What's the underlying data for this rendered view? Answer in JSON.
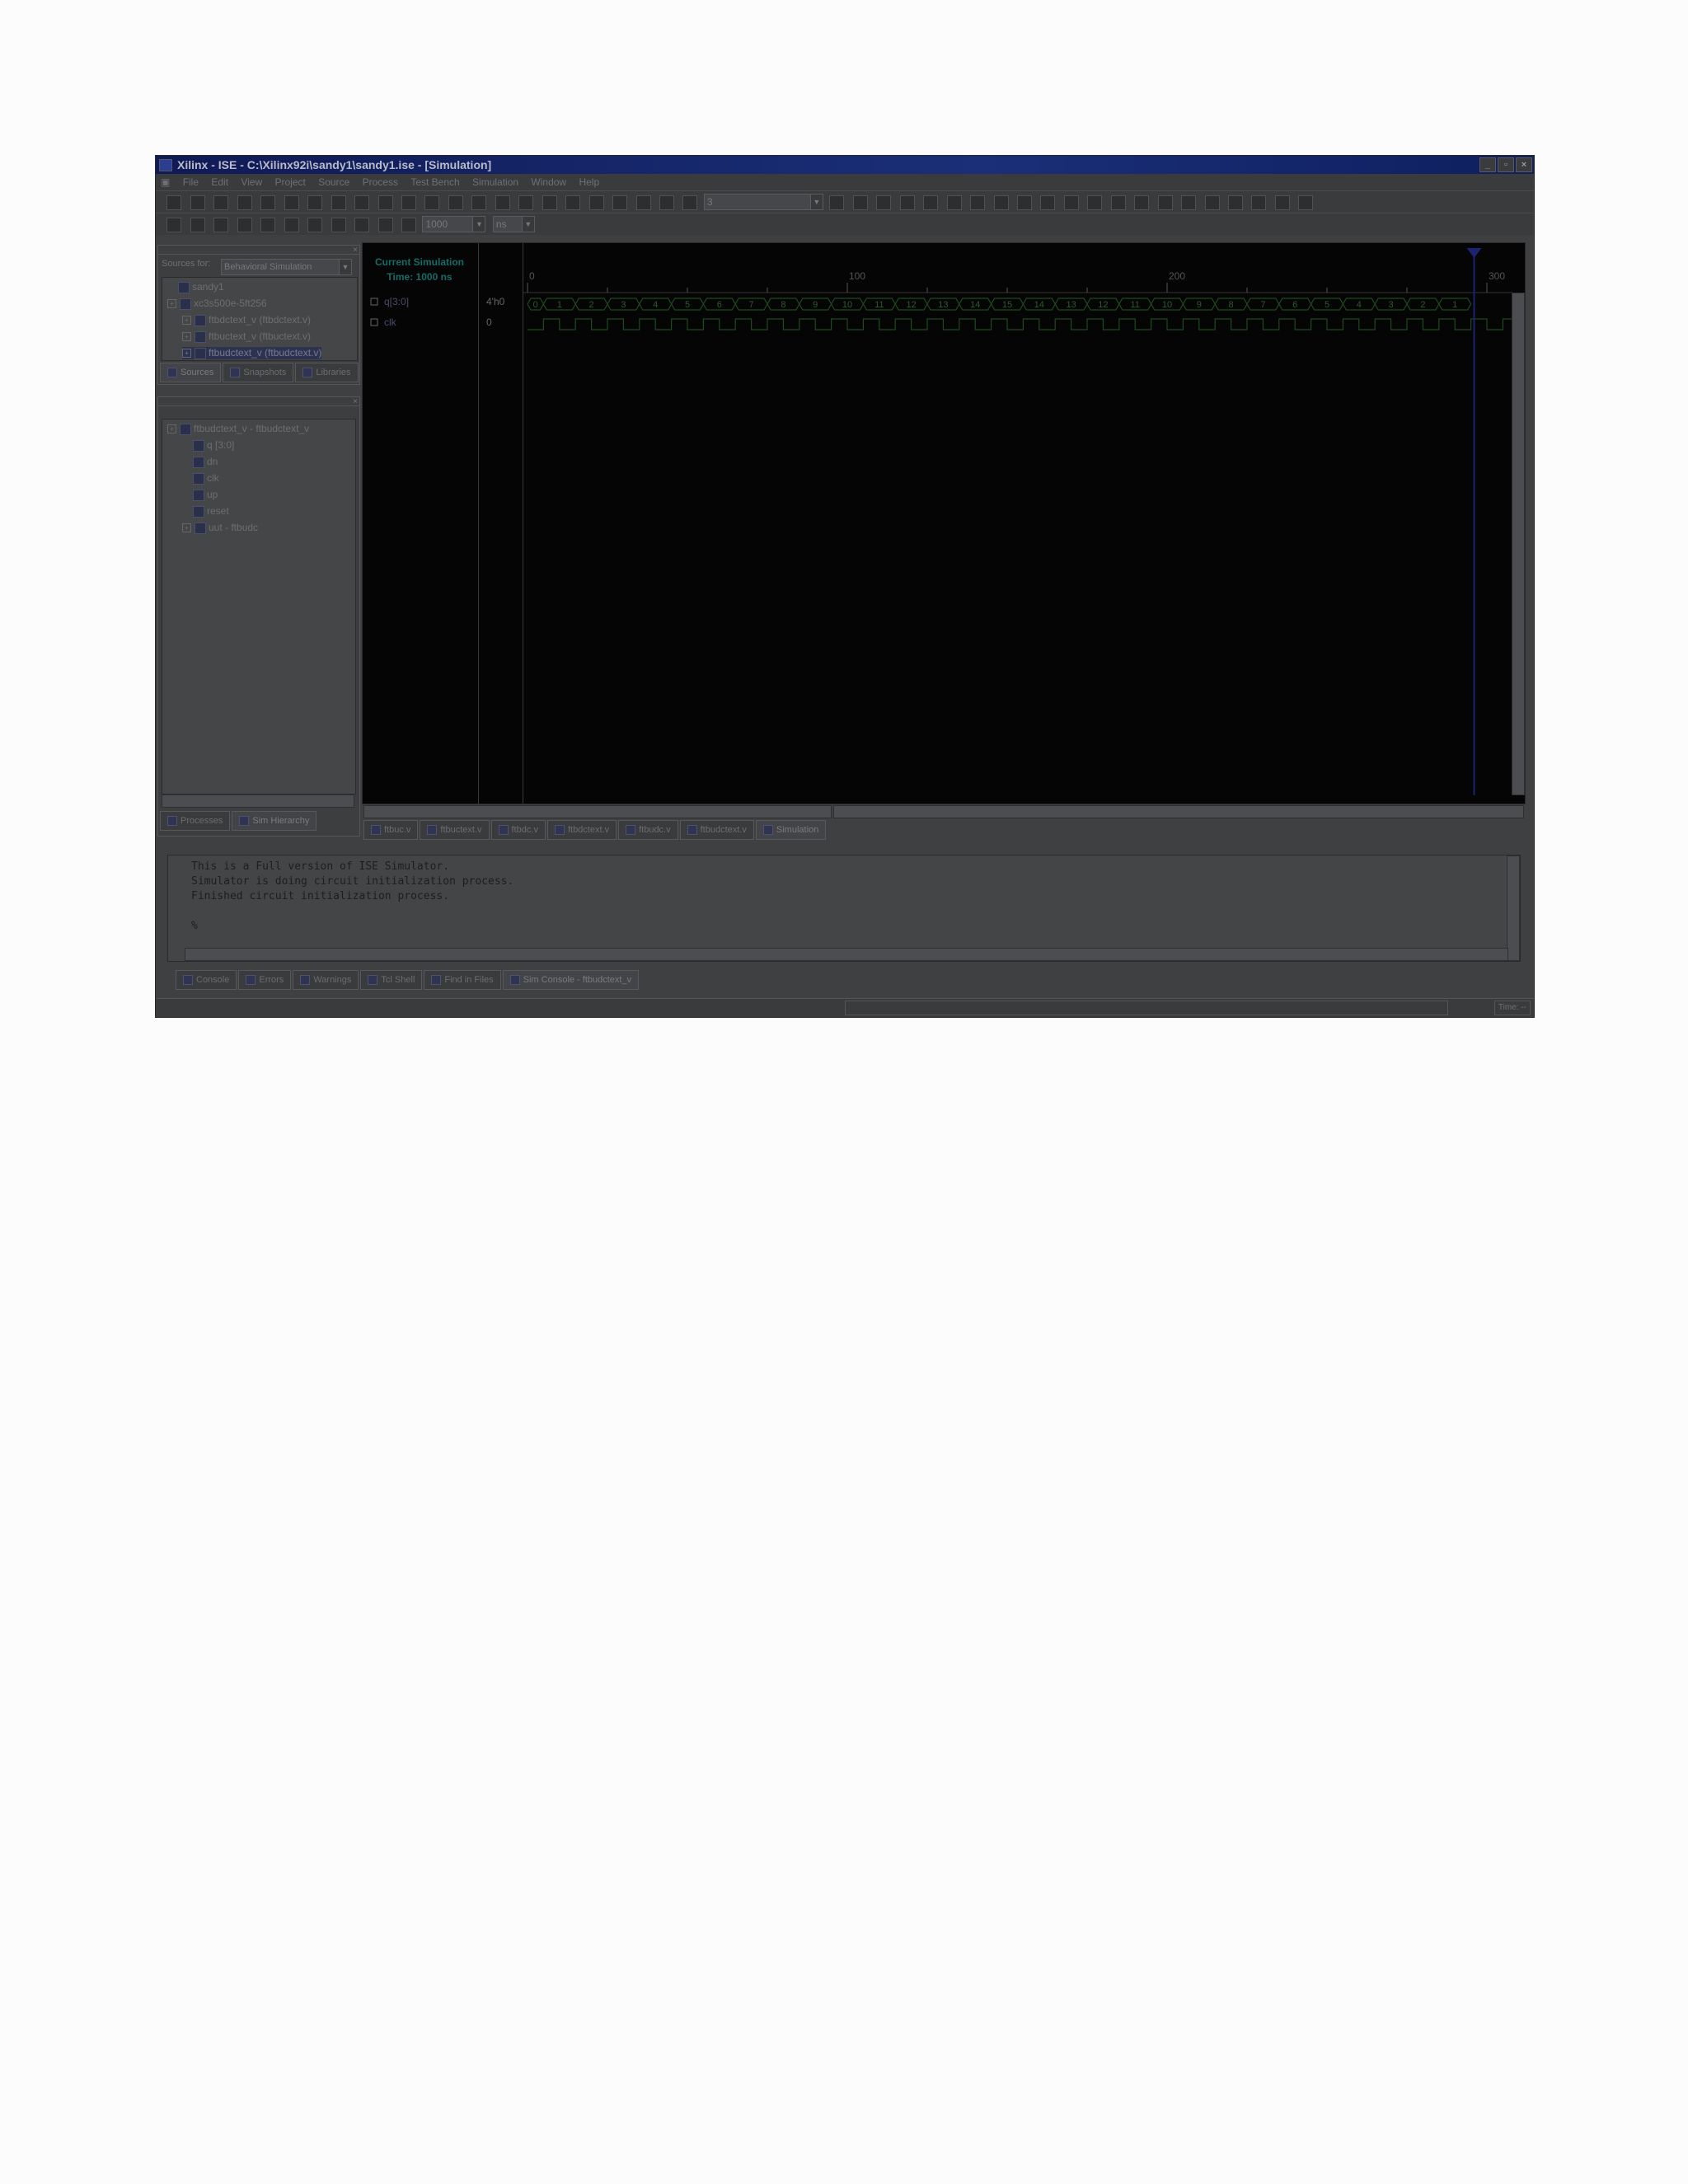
{
  "window": {
    "title": "Xilinx - ISE - C:\\Xilinx92i\\sandy1\\sandy1.ise - [Simulation]",
    "controls": [
      "_",
      "▫",
      "×"
    ]
  },
  "menu": [
    "File",
    "Edit",
    "View",
    "Project",
    "Source",
    "Process",
    "Test Bench",
    "Simulation",
    "Window",
    "Help"
  ],
  "toolbar": {
    "search_combo_value": "3",
    "sim_time_value": "1000",
    "sim_time_unit": "ns"
  },
  "sources_panel": {
    "label": "Sources for:",
    "view_value": "Behavioral Simulation",
    "tree": [
      {
        "text": "sandy1",
        "indent": 0,
        "plus": false
      },
      {
        "text": "xc3s500e-5ft256",
        "indent": 0,
        "plus": true
      },
      {
        "text": "ftbdctext_v (ftbdctext.v)",
        "indent": 1,
        "plus": true
      },
      {
        "text": "ftbuctext_v (ftbuctext.v)",
        "indent": 1,
        "plus": true
      },
      {
        "text": "ftbudctext_v (ftbudctext.v)",
        "indent": 1,
        "plus": true,
        "selected": true
      }
    ],
    "tabs": [
      "Sources",
      "Snapshots",
      "Libraries"
    ]
  },
  "hierarchy_panel": {
    "tree": [
      {
        "text": "ftbudctext_v - ftbudctext_v",
        "indent": 0,
        "plus": true
      },
      {
        "text": "q [3:0]",
        "indent": 1
      },
      {
        "text": "dn",
        "indent": 1
      },
      {
        "text": "clk",
        "indent": 1
      },
      {
        "text": "up",
        "indent": 1
      },
      {
        "text": "reset",
        "indent": 1
      },
      {
        "text": "uut - ftbudc",
        "indent": 1,
        "plus": true
      }
    ],
    "tabs": [
      "Processes",
      "Sim Hierarchy"
    ]
  },
  "waveform": {
    "current_simulation_line1": "Current Simulation",
    "current_simulation_line2": "Time: 1000 ns",
    "ruler_labels": [
      {
        "text": "0",
        "t": 0
      },
      {
        "text": "100",
        "t": 100
      },
      {
        "text": "200",
        "t": 200
      },
      {
        "text": "300",
        "t": 300
      }
    ],
    "cursor_time": 296,
    "signals": [
      {
        "name": "q[3:0]",
        "value": "4'h0"
      },
      {
        "name": "clk",
        "value": "0"
      }
    ],
    "bus_values": [
      "0",
      "1",
      "2",
      "3",
      "4",
      "5",
      "6",
      "7",
      "8",
      "9",
      "10",
      "11",
      "12",
      "13",
      "14",
      "15",
      "14",
      "13",
      "12",
      "11",
      "10",
      "9",
      "8",
      "7",
      "6",
      "5",
      "4",
      "3",
      "2",
      "1"
    ],
    "editor_tabs": [
      "ftbuc.v",
      "ftbuctext.v",
      "ftbdc.v",
      "ftbdctext.v",
      "ftbudc.v",
      "ftbudctext.v",
      "Simulation"
    ]
  },
  "console": {
    "lines": [
      "This is a Full version of ISE Simulator.",
      "Simulator is doing circuit initialization process.",
      "Finished circuit initialization process.",
      "%"
    ],
    "tabs": [
      "Console",
      "Errors",
      "Warnings",
      "Tcl Shell",
      "Find in Files",
      "Sim Console - ftbudctext_v"
    ]
  },
  "status": {
    "time_label": "Time: --"
  }
}
